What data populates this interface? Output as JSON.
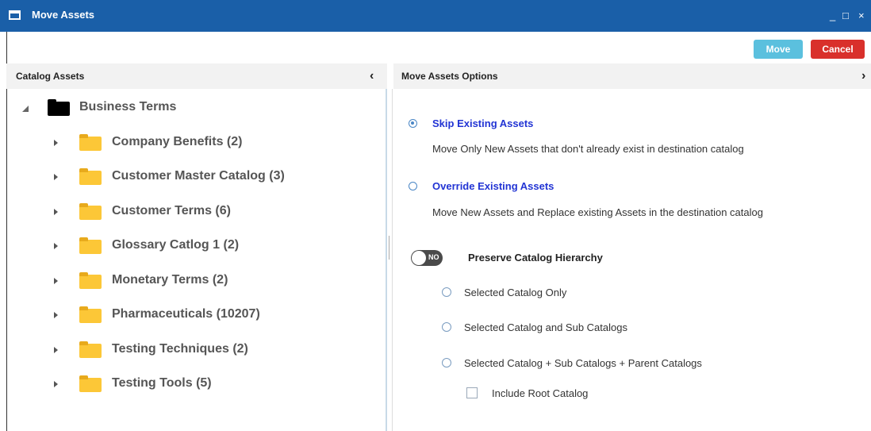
{
  "window": {
    "title": "Move Assets",
    "icon": "window-icon",
    "controls": {
      "minimize": "_",
      "maximize": "□",
      "close": "×"
    }
  },
  "toolbar": {
    "move_label": "Move",
    "cancel_label": "Cancel",
    "colors": {
      "move": "#5bc0de",
      "cancel": "#d9302b",
      "titlebar": "#1a5fa8"
    }
  },
  "left_panel": {
    "title": "Catalog Assets",
    "collapse_glyph": "‹",
    "tree": {
      "root": {
        "label": "Business Terms",
        "expanded": true
      },
      "children": [
        {
          "label": "Company Benefits (2)"
        },
        {
          "label": "Customer Master Catalog (3)"
        },
        {
          "label": "Customer Terms (6)"
        },
        {
          "label": "Glossary Catlog 1 (2)"
        },
        {
          "label": "Monetary Terms (2)"
        },
        {
          "label": "Pharmaceuticals (10207)"
        },
        {
          "label": "Testing Techniques (2)"
        },
        {
          "label": "Testing Tools (5)"
        }
      ]
    }
  },
  "right_panel": {
    "title": "Move Assets Options",
    "expand_glyph": "›",
    "options": [
      {
        "title": "Skip Existing Assets",
        "description": "Move Only New Assets that don't already exist in destination catalog",
        "selected": true
      },
      {
        "title": "Override Existing Assets",
        "description": "Move New Assets and Replace existing Assets in the destination catalog",
        "selected": false
      }
    ],
    "hierarchy": {
      "toggle_text": "NO",
      "toggle_on": false,
      "label": "Preserve Catalog Hierarchy",
      "choices": [
        {
          "label": "Selected Catalog Only"
        },
        {
          "label": "Selected Catalog and Sub Catalogs"
        },
        {
          "label": "Selected Catalog + Sub Catalogs + Parent Catalogs"
        }
      ],
      "include_root": {
        "label": "Include Root Catalog",
        "checked": false
      }
    }
  }
}
